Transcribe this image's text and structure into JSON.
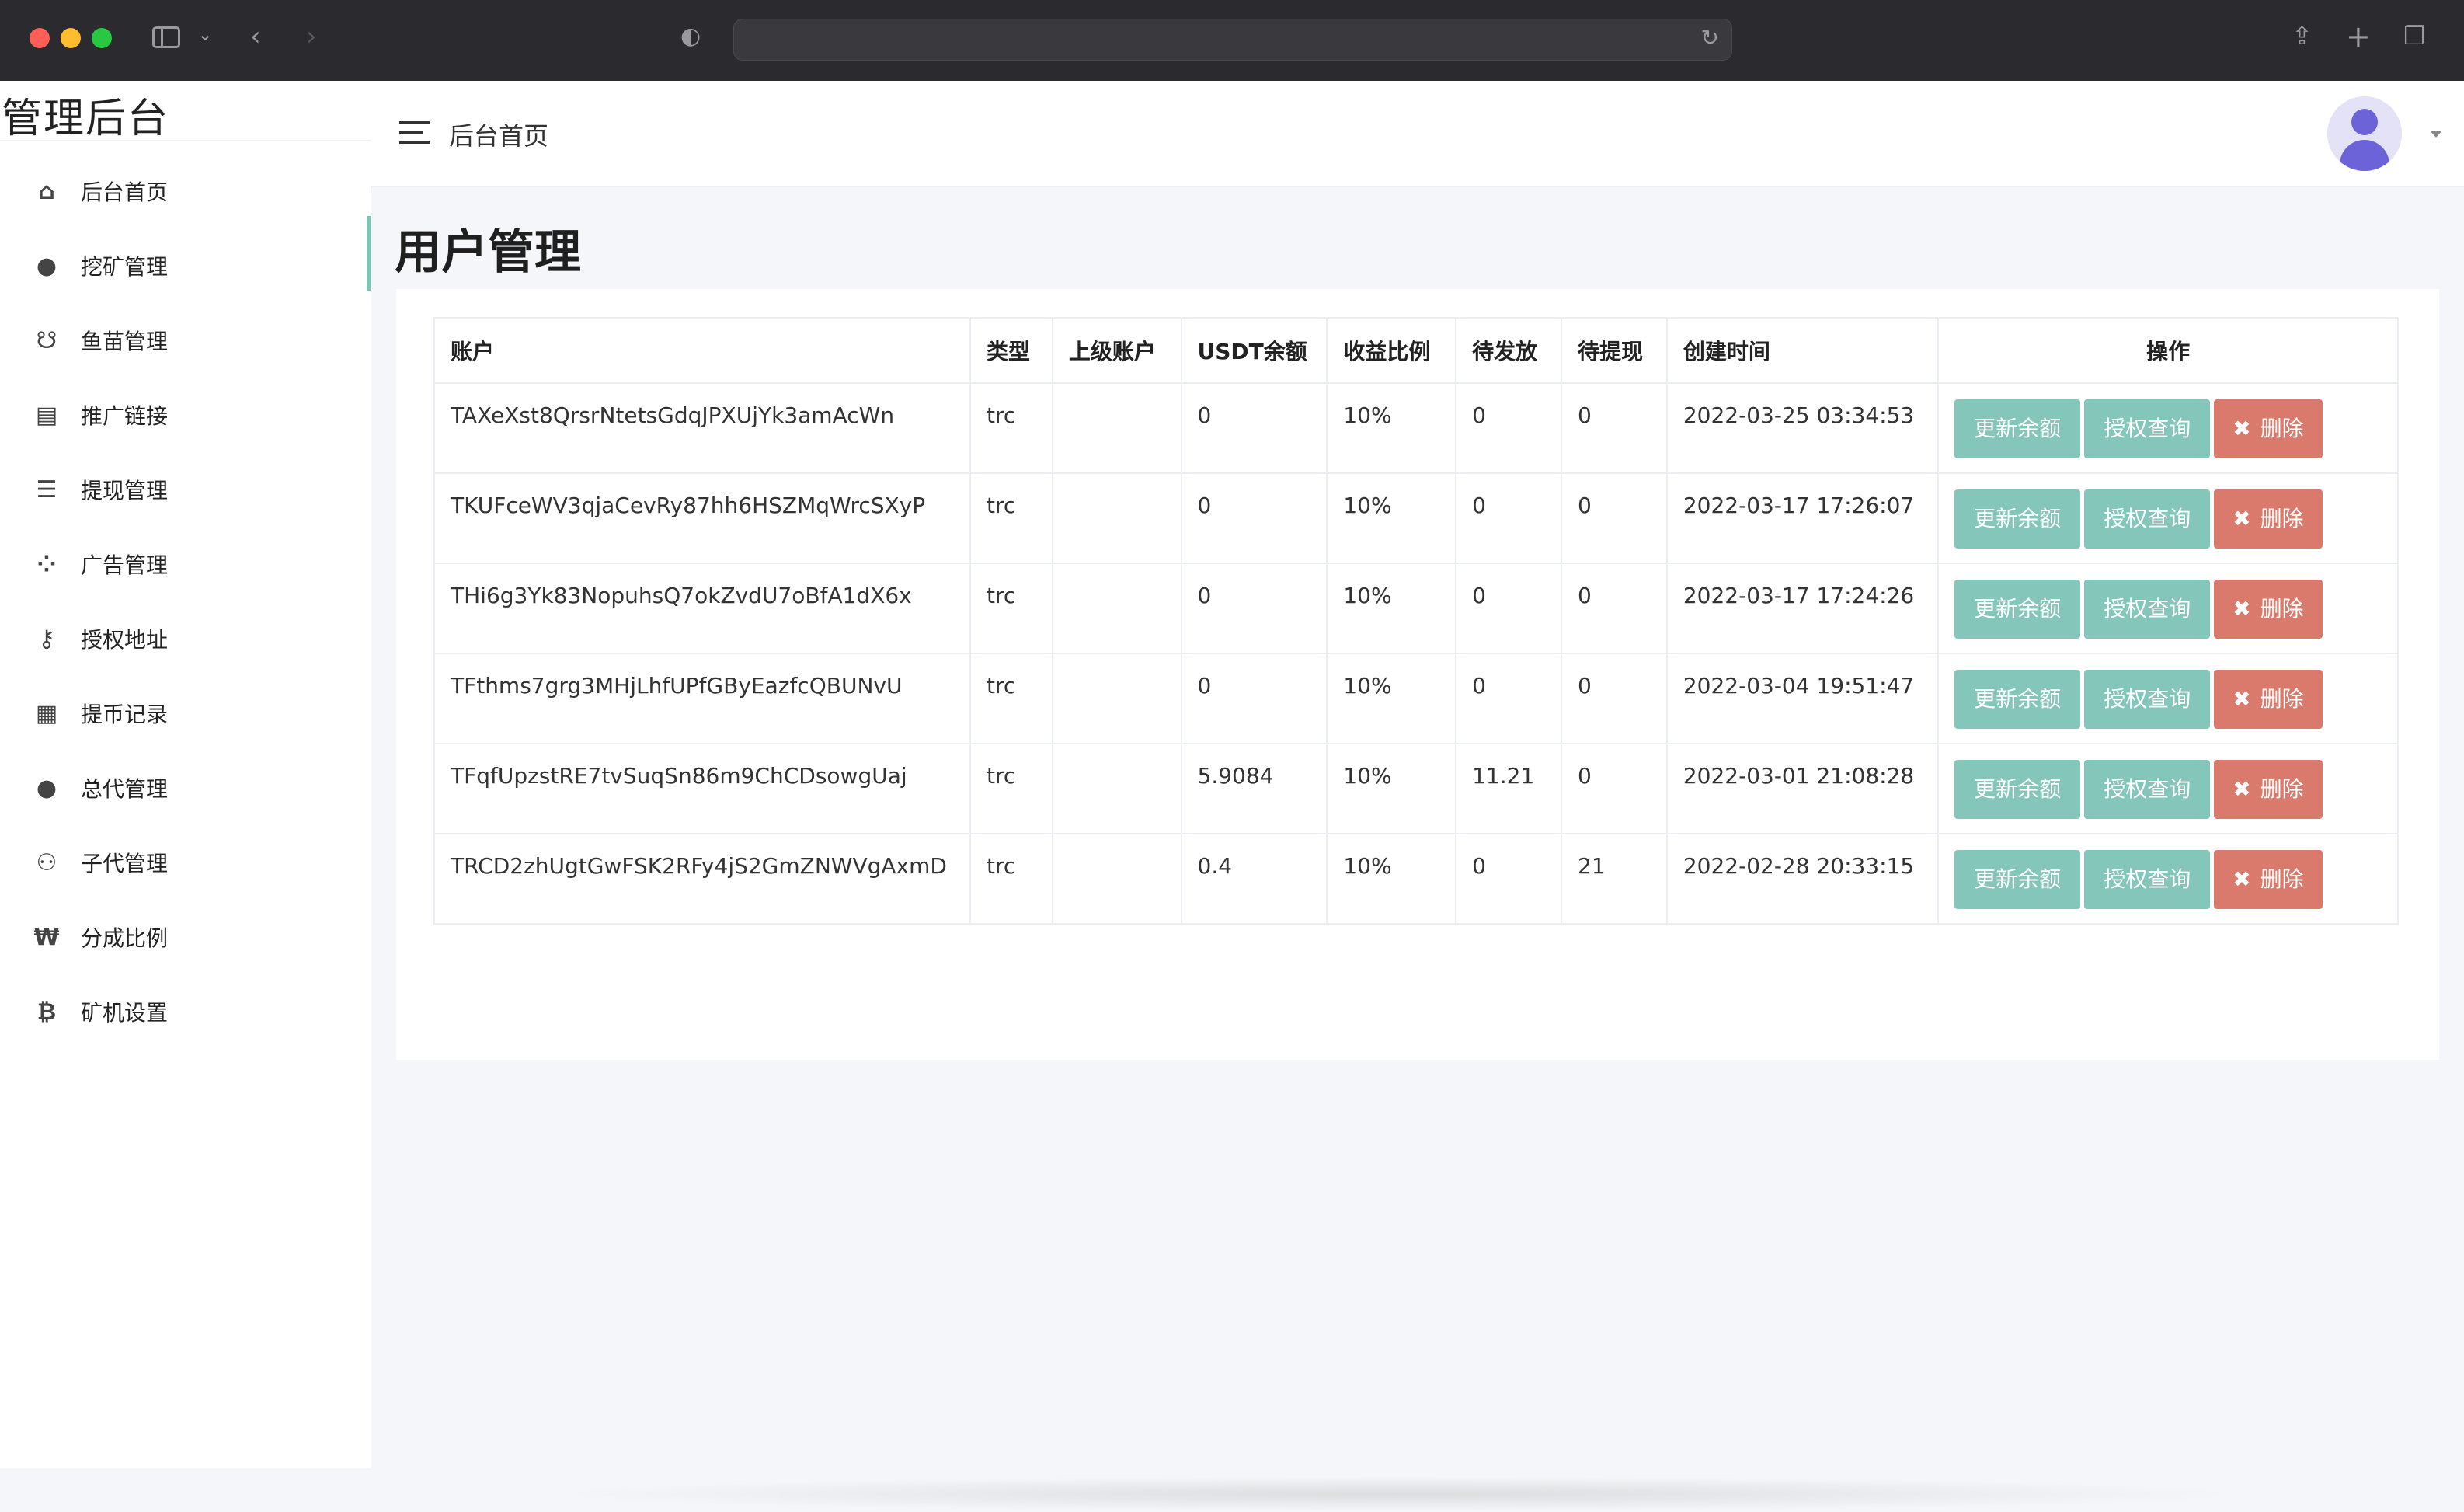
{
  "brand": {
    "title": "管理后台"
  },
  "header": {
    "breadcrumb": "后台首页"
  },
  "sidebar": {
    "items": [
      {
        "icon": "home-icon",
        "glyph": "⌂",
        "label": "后台首页"
      },
      {
        "icon": "user-icon",
        "glyph": "●",
        "label": "挖矿管理"
      },
      {
        "icon": "bug-icon",
        "glyph": "☋",
        "label": "鱼苗管理"
      },
      {
        "icon": "file-icon",
        "glyph": "▤",
        "label": "推广链接"
      },
      {
        "icon": "list-icon",
        "glyph": "☰",
        "label": "提现管理"
      },
      {
        "icon": "grid-icon",
        "glyph": "⁘",
        "label": "广告管理"
      },
      {
        "icon": "key-icon",
        "glyph": "⚷",
        "label": "授权地址"
      },
      {
        "icon": "receipt-icon",
        "glyph": "▦",
        "label": "提币记录"
      },
      {
        "icon": "user-icon",
        "glyph": "●",
        "label": "总代管理"
      },
      {
        "icon": "users-icon",
        "glyph": "⚇",
        "label": "子代管理"
      },
      {
        "icon": "won-icon",
        "glyph": "₩",
        "label": "分成比例"
      },
      {
        "icon": "bitcoin-icon",
        "glyph": "₿",
        "label": "矿机设置"
      }
    ]
  },
  "page": {
    "title": "用户管理"
  },
  "table": {
    "headers": [
      "账户",
      "类型",
      "上级账户",
      "USDT余额",
      "收益比例",
      "待发放",
      "待提现",
      "创建时间",
      "操作"
    ],
    "rows": [
      {
        "account": "TAXeXst8QrsrNtetsGdqJPXUjYk3amAcWn",
        "type": "trc",
        "parent": "",
        "usdt": "0",
        "ratio": "10%",
        "pending": "0",
        "withdraw": "0",
        "created": "2022-03-25 03:34:53"
      },
      {
        "account": "TKUFceWV3qjaCevRy87hh6HSZMqWrcSXyP",
        "type": "trc",
        "parent": "",
        "usdt": "0",
        "ratio": "10%",
        "pending": "0",
        "withdraw": "0",
        "created": "2022-03-17 17:26:07"
      },
      {
        "account": "THi6g3Yk83NopuhsQ7okZvdU7oBfA1dX6x",
        "type": "trc",
        "parent": "",
        "usdt": "0",
        "ratio": "10%",
        "pending": "0",
        "withdraw": "0",
        "created": "2022-03-17 17:24:26"
      },
      {
        "account": "TFthms7grg3MHjLhfUPfGByEazfcQBUNvU",
        "type": "trc",
        "parent": "",
        "usdt": "0",
        "ratio": "10%",
        "pending": "0",
        "withdraw": "0",
        "created": "2022-03-04 19:51:47"
      },
      {
        "account": "TFqfUpzstRE7tvSuqSn86m9ChCDsowgUaj",
        "type": "trc",
        "parent": "",
        "usdt": "5.9084",
        "ratio": "10%",
        "pending": "11.21",
        "withdraw": "0",
        "created": "2022-03-01 21:08:28"
      },
      {
        "account": "TRCD2zhUgtGwFSK2RFy4jS2GmZNWVgAxmD",
        "type": "trc",
        "parent": "",
        "usdt": "0.4",
        "ratio": "10%",
        "pending": "0",
        "withdraw": "21",
        "created": "2022-02-28 20:33:15"
      }
    ],
    "actions": {
      "update": "更新余额",
      "auth": "授权查询",
      "delete": "删除"
    }
  },
  "colors": {
    "accent": "#84c6b9",
    "danger": "#d97a6c",
    "avatar": "#6c63d9"
  }
}
